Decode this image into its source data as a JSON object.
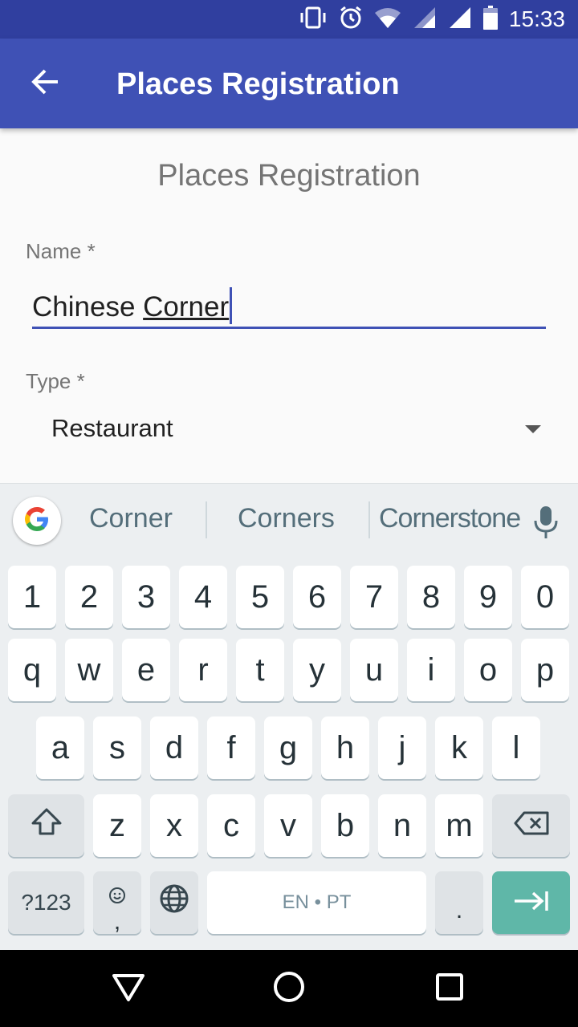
{
  "status_bar": {
    "time": "15:33",
    "icons": [
      "vibrate-icon",
      "alarm-icon",
      "wifi-icon",
      "signal-icon",
      "signal-icon",
      "battery-icon"
    ]
  },
  "app_bar": {
    "title": "Places Registration",
    "back_icon": "arrow-back-icon"
  },
  "form": {
    "title": "Places Registration",
    "name_label": "Name *",
    "name_value_prefix": "Chinese ",
    "name_value_underlined": "Corner",
    "type_label": "Type *",
    "type_value": "Restaurant"
  },
  "keyboard": {
    "suggestions": [
      "Corner",
      "Corners",
      "Cornerstone"
    ],
    "row_numbers": [
      "1",
      "2",
      "3",
      "4",
      "5",
      "6",
      "7",
      "8",
      "9",
      "0"
    ],
    "row_top": [
      "q",
      "w",
      "e",
      "r",
      "t",
      "y",
      "u",
      "i",
      "o",
      "p"
    ],
    "row_middle": [
      "a",
      "s",
      "d",
      "f",
      "g",
      "h",
      "j",
      "k",
      "l"
    ],
    "row_bottom": [
      "z",
      "x",
      "c",
      "v",
      "b",
      "n",
      "m"
    ],
    "symbols_label": "?123",
    "comma_label": ",",
    "space_label": "EN • PT",
    "period_label": "."
  },
  "colors": {
    "status_bar": "#303f9f",
    "app_bar": "#3f51b5",
    "accent": "#3f51b5",
    "enter_key": "#5fb7a8"
  }
}
